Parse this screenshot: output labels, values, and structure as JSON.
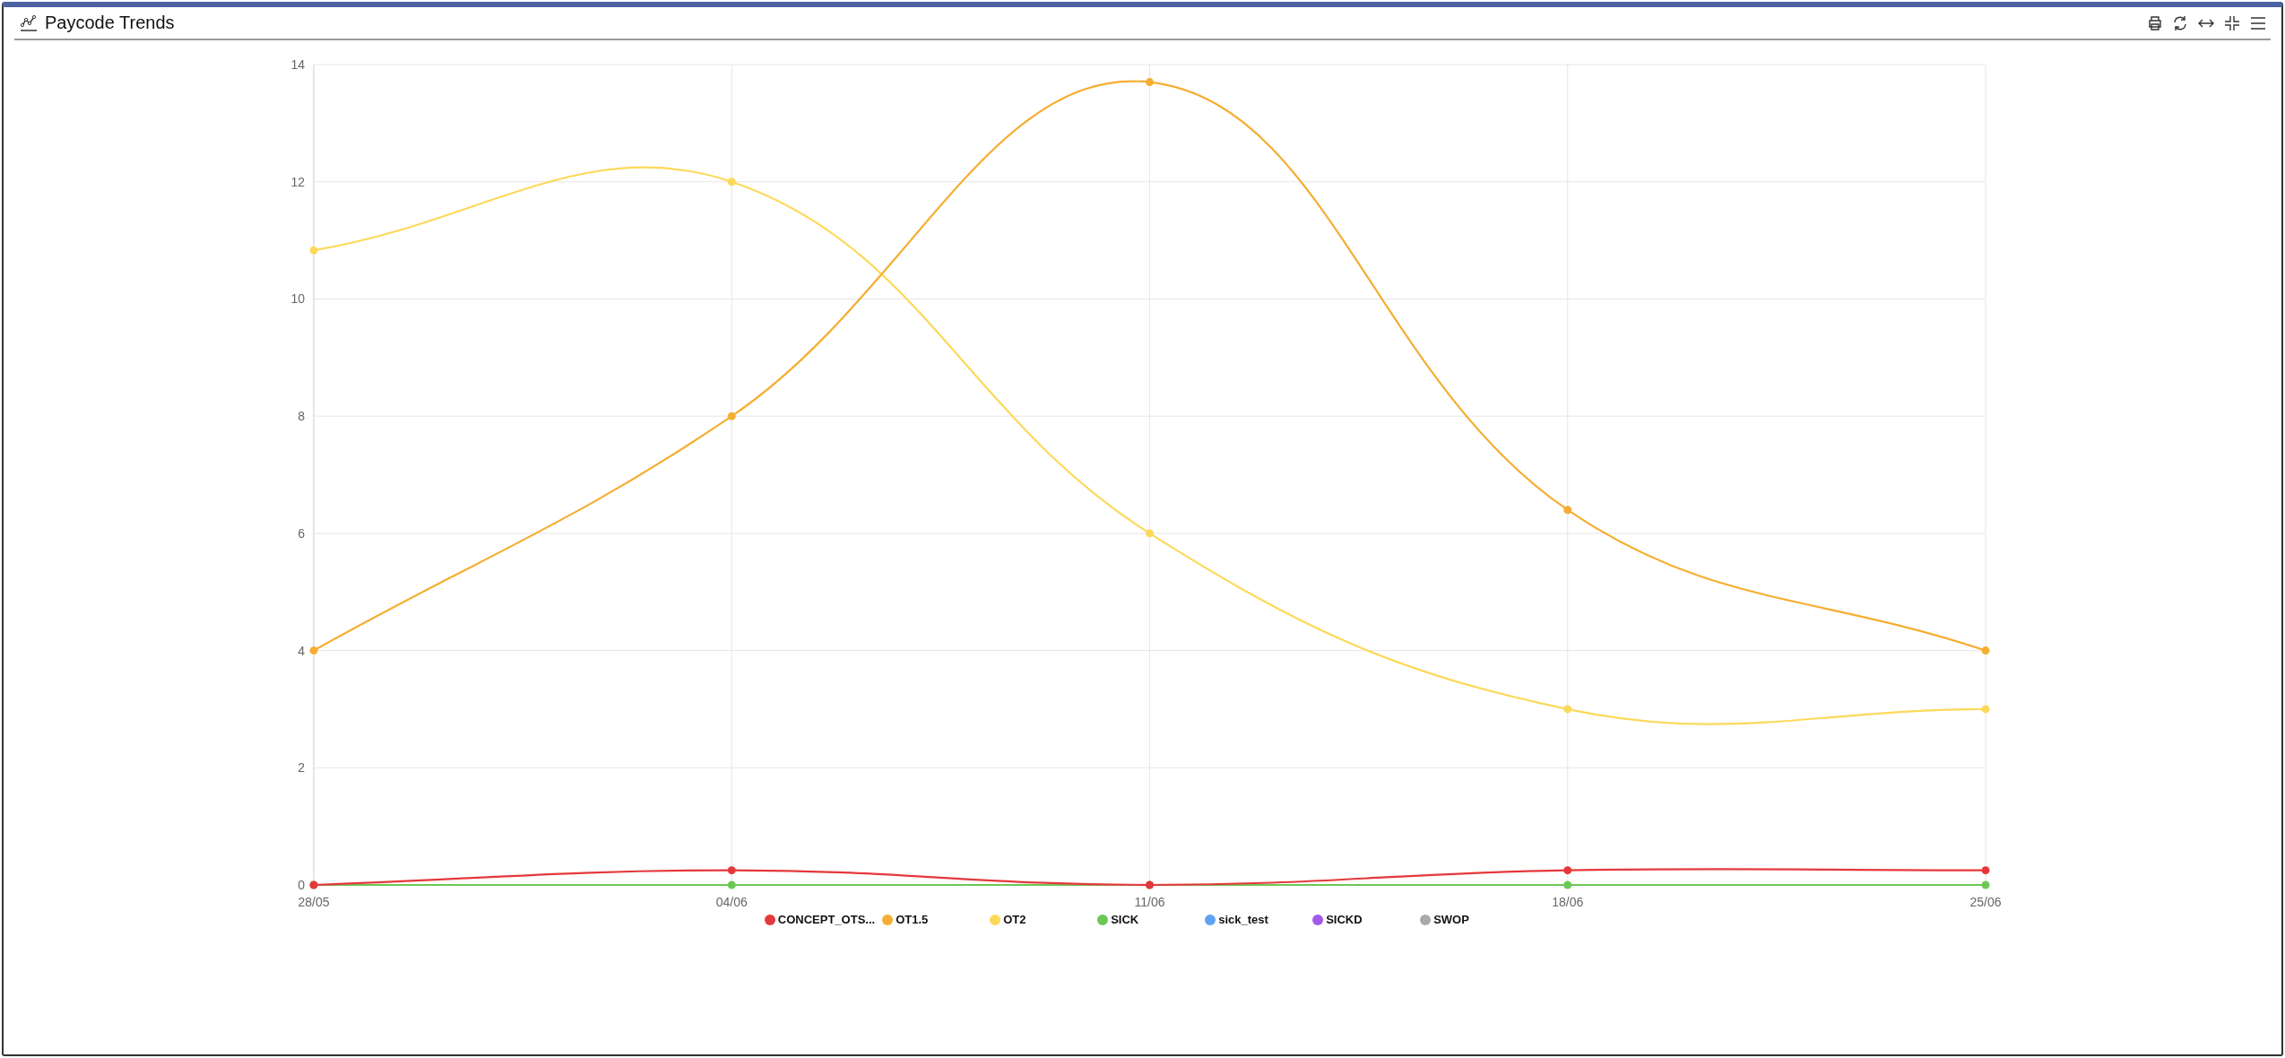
{
  "panel": {
    "title": "Paycode Trends"
  },
  "chart_data": {
    "type": "line",
    "categories": [
      "28/05",
      "04/06",
      "11/06",
      "18/06",
      "25/06"
    ],
    "ylim": [
      0,
      14
    ],
    "grid": true,
    "yticks": [
      0,
      2,
      4,
      6,
      8,
      10,
      12,
      14
    ],
    "series": [
      {
        "name": "CONCEPT_OTS...",
        "color": "#e5383b",
        "marker": true,
        "values": [
          0,
          0.25,
          0,
          0.25,
          0.25
        ]
      },
      {
        "name": "OT1.5",
        "color": "#f5ae32",
        "marker": true,
        "values": [
          4,
          8,
          13.7,
          6.4,
          4
        ]
      },
      {
        "name": "OT2",
        "color": "#fcd95a",
        "marker": true,
        "values": [
          10.83,
          12,
          6,
          3,
          3
        ]
      },
      {
        "name": "SICK",
        "color": "#6cc856",
        "marker": true,
        "values": [
          0,
          0,
          0,
          0,
          0
        ]
      },
      {
        "name": "sick_test",
        "color": "#5ea2f2",
        "values": [
          null,
          null,
          null,
          null,
          null
        ]
      },
      {
        "name": "SICKD",
        "color": "#a55ae8",
        "values": [
          null,
          null,
          null,
          null,
          null
        ]
      },
      {
        "name": "SWOP",
        "color": "#aaaaaa",
        "values": [
          null,
          null,
          null,
          null,
          null
        ]
      }
    ]
  }
}
